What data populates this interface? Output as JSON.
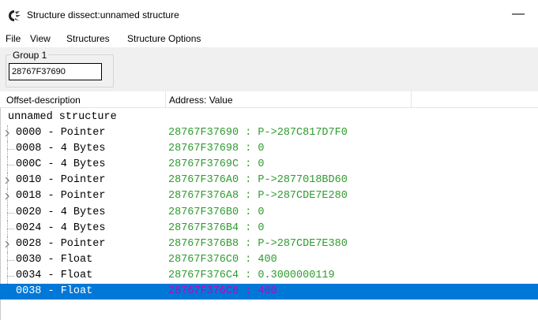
{
  "window": {
    "title": "Structure dissect:unnamed structure",
    "minimize_glyph": "—"
  },
  "menu": [
    "File",
    "View",
    "Structures",
    "Structure Options"
  ],
  "group": {
    "label": "Group 1",
    "address": "28767F37690"
  },
  "columns": {
    "offset": "Offset-description",
    "value": "Address: Value"
  },
  "tree": {
    "root": "unnamed structure",
    "rows": [
      {
        "label": "0000 - Pointer",
        "value": "28767F37690 : P->287C817D7F0",
        "expandable": true
      },
      {
        "label": "0008 - 4 Bytes",
        "value": "28767F37698 : 0",
        "expandable": false
      },
      {
        "label": "000C - 4 Bytes",
        "value": "28767F3769C : 0",
        "expandable": false
      },
      {
        "label": "0010 - Pointer",
        "value": "28767F376A0 : P->2877018BD60",
        "expandable": true
      },
      {
        "label": "0018 - Pointer",
        "value": "28767F376A8 : P->287CDE7E280",
        "expandable": true
      },
      {
        "label": "0020 - 4 Bytes",
        "value": "28767F376B0 : 0",
        "expandable": false
      },
      {
        "label": "0024 - 4 Bytes",
        "value": "28767F376B4 : 0",
        "expandable": false
      },
      {
        "label": "0028 - Pointer",
        "value": "28767F376B8 : P->287CDE7E380",
        "expandable": true
      },
      {
        "label": "0030 - Float",
        "value": "28767F376C0 : 400",
        "expandable": false
      },
      {
        "label": "0034 - Float",
        "value": "28767F376C4 : 0.3000000119",
        "expandable": false
      },
      {
        "label": "0038 - Float",
        "value": "28767F376C8 : 400",
        "expandable": false,
        "selected": true
      }
    ]
  },
  "colors": {
    "value_green": "#2f9b2f",
    "selection_blue": "#0078d7",
    "selected_value": "#c000c0"
  }
}
